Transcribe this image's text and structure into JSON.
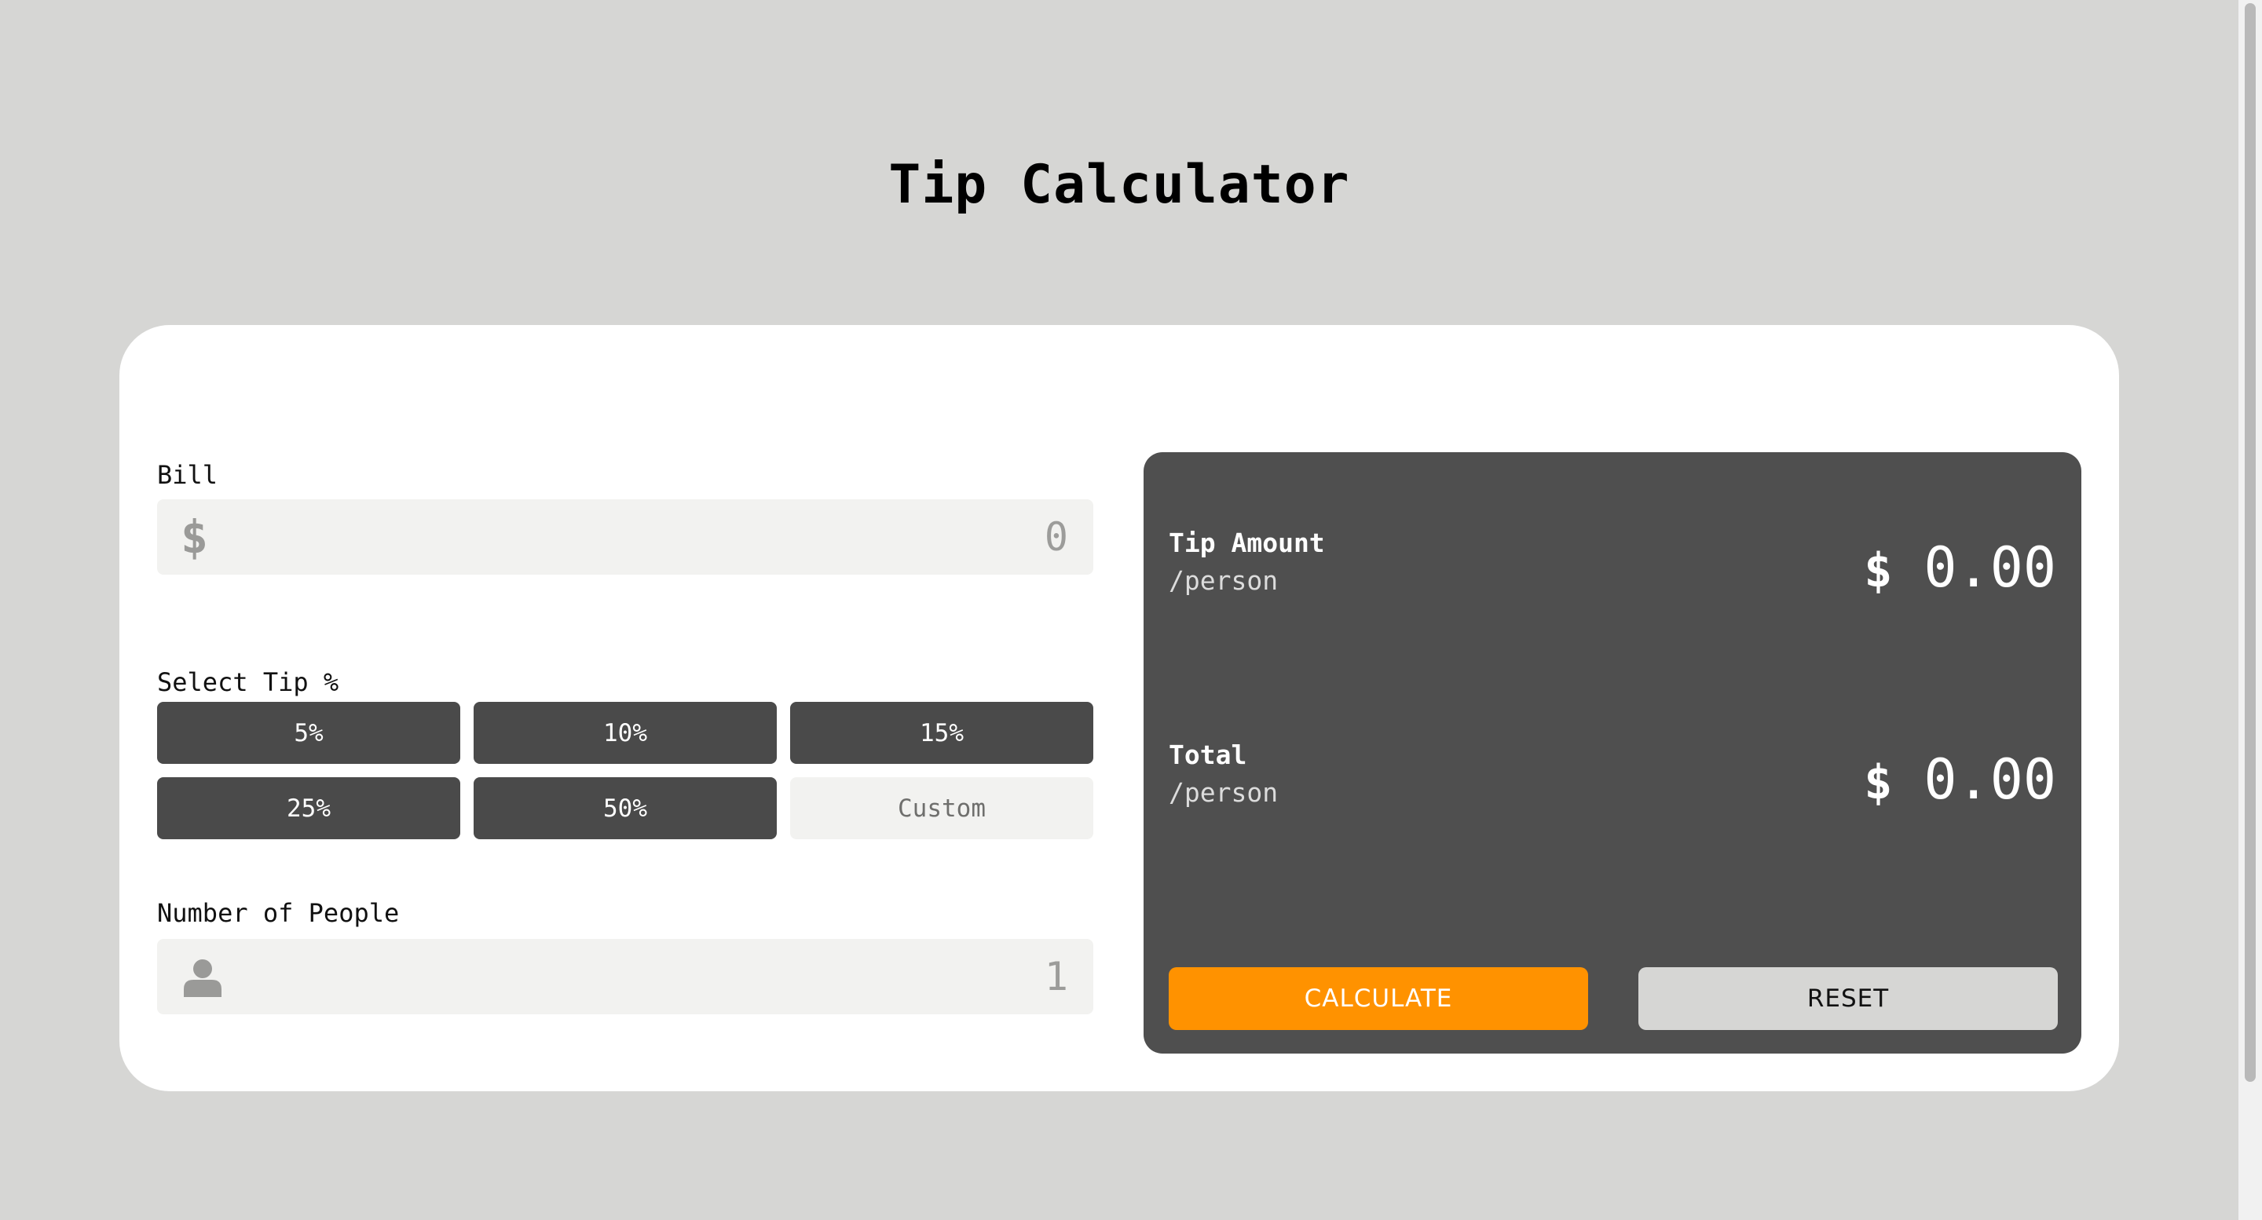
{
  "title": "Tip Calculator",
  "bill": {
    "label": "Bill",
    "icon": "dollar-icon",
    "icon_glyph": "$",
    "value": "0"
  },
  "tip": {
    "label": "Select Tip %",
    "options": [
      "5%",
      "10%",
      "15%",
      "25%",
      "50%"
    ],
    "custom_placeholder": "Custom"
  },
  "people": {
    "label": "Number of People",
    "icon": "person-icon",
    "value": "1"
  },
  "results": {
    "tip_amount": {
      "title": "Tip Amount",
      "sub": "/person",
      "currency": "$",
      "value": "0.00"
    },
    "total": {
      "title": "Total",
      "sub": "/person",
      "currency": "$",
      "value": "0.00"
    }
  },
  "actions": {
    "calculate_label": "CALCULATE",
    "reset_label": "RESET"
  },
  "colors": {
    "background": "#d6d6d4",
    "panel": "#4f4f4f",
    "tip_button": "#4a4a4a",
    "accent": "#ff9200",
    "field": "#f2f2f0"
  }
}
